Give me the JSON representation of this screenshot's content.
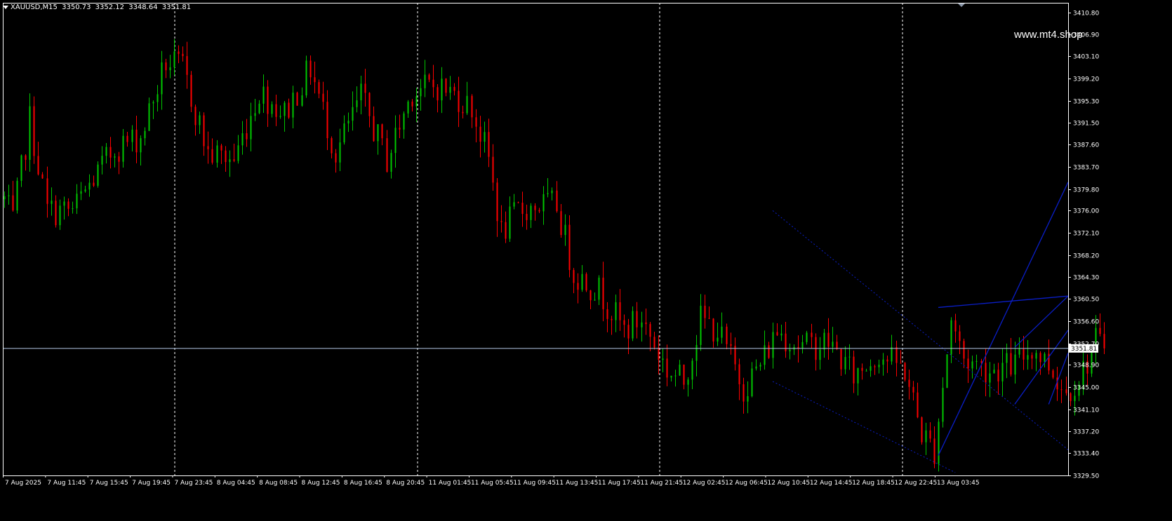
{
  "header": {
    "symbol": "XAUUSD,M15",
    "open": "3350.73",
    "high": "3352.12",
    "low": "3348.64",
    "close": "3351.81"
  },
  "watermark": "www.mt4.shop",
  "colors": {
    "background": "#000000",
    "bull": "#00c800",
    "bear": "#ff0000",
    "frame": "#ffffff",
    "separator": "#ffffff",
    "bid_line": "#b4c8e6",
    "trendline": "#0a1ec8"
  },
  "chart_data": {
    "type": "candlestick",
    "symbol": "XAUUSD",
    "timeframe": "M15",
    "y_range": [
      3329.5,
      3412.5
    ],
    "y_ticks": [
      "3410.80",
      "3406.90",
      "3403.10",
      "3399.20",
      "3395.30",
      "3391.50",
      "3387.60",
      "3383.70",
      "3379.80",
      "3376.00",
      "3372.10",
      "3368.20",
      "3364.30",
      "3360.50",
      "3356.60",
      "3352.70",
      "3348.90",
      "3345.00",
      "3341.10",
      "3337.20",
      "3333.40",
      "3329.50"
    ],
    "x_ticks": [
      "7 Aug 2025",
      "7 Aug 11:45",
      "7 Aug 15:45",
      "7 Aug 19:45",
      "7 Aug 23:45",
      "8 Aug 04:45",
      "8 Aug 08:45",
      "8 Aug 12:45",
      "8 Aug 16:45",
      "8 Aug 20:45",
      "11 Aug 01:45",
      "11 Aug 05:45",
      "11 Aug 09:45",
      "11 Aug 13:45",
      "11 Aug 17:45",
      "11 Aug 21:45",
      "12 Aug 02:45",
      "12 Aug 06:45",
      "12 Aug 10:45",
      "12 Aug 14:45",
      "12 Aug 18:45",
      "12 Aug 22:45",
      "13 Aug 03:45"
    ],
    "period_separators": [
      "8 Aug",
      "11 Aug",
      "12 Aug",
      "13 Aug"
    ],
    "current_price": "3351.81",
    "grid": false,
    "price_path": [
      {
        "t": 0,
        "p": 3378
      },
      {
        "t": 2,
        "p": 3374
      },
      {
        "t": 6,
        "p": 3392
      },
      {
        "t": 10,
        "p": 3376
      },
      {
        "t": 16,
        "p": 3376
      },
      {
        "t": 26,
        "p": 3387
      },
      {
        "t": 32,
        "p": 3389
      },
      {
        "t": 38,
        "p": 3402
      },
      {
        "t": 42,
        "p": 3401
      },
      {
        "t": 48,
        "p": 3386
      },
      {
        "t": 54,
        "p": 3385
      },
      {
        "t": 60,
        "p": 3397
      },
      {
        "t": 66,
        "p": 3393
      },
      {
        "t": 72,
        "p": 3401
      },
      {
        "t": 78,
        "p": 3386
      },
      {
        "t": 84,
        "p": 3396
      },
      {
        "t": 90,
        "p": 3385
      },
      {
        "t": 96,
        "p": 3397
      },
      {
        "t": 102,
        "p": 3398
      },
      {
        "t": 107,
        "p": 3396
      },
      {
        "t": 110,
        "p": 3394
      },
      {
        "t": 114,
        "p": 3385
      },
      {
        "t": 117,
        "p": 3372
      },
      {
        "t": 121,
        "p": 3376
      },
      {
        "t": 126,
        "p": 3377
      },
      {
        "t": 130,
        "p": 3377
      },
      {
        "t": 134,
        "p": 3365
      },
      {
        "t": 140,
        "p": 3362
      },
      {
        "t": 146,
        "p": 3355
      },
      {
        "t": 150,
        "p": 3357
      },
      {
        "t": 156,
        "p": 3348
      },
      {
        "t": 160,
        "p": 3346
      },
      {
        "t": 164,
        "p": 3357
      },
      {
        "t": 168,
        "p": 3355
      },
      {
        "t": 174,
        "p": 3345
      },
      {
        "t": 178,
        "p": 3349
      },
      {
        "t": 182,
        "p": 3355
      },
      {
        "t": 188,
        "p": 3352
      },
      {
        "t": 194,
        "p": 3353
      },
      {
        "t": 200,
        "p": 3347
      },
      {
        "t": 206,
        "p": 3351
      },
      {
        "t": 212,
        "p": 3348
      },
      {
        "t": 216,
        "p": 3337
      },
      {
        "t": 219,
        "p": 3334
      },
      {
        "t": 223,
        "p": 3357
      },
      {
        "t": 226,
        "p": 3350
      },
      {
        "t": 232,
        "p": 3348
      },
      {
        "t": 238,
        "p": 3349
      },
      {
        "t": 242,
        "p": 3352
      },
      {
        "t": 246,
        "p": 3349
      },
      {
        "t": 250,
        "p": 3344
      },
      {
        "t": 254,
        "p": 3348
      },
      {
        "t": 257,
        "p": 3353
      },
      {
        "t": 259,
        "p": 3351.81
      }
    ],
    "trendlines": [
      {
        "style": "dotted",
        "t1": 181,
        "p1": 3376,
        "t2": 290,
        "p2": 3334
      },
      {
        "style": "dotted",
        "t1": 181,
        "p1": 3346,
        "t2": 224,
        "p2": 3330
      },
      {
        "style": "solid",
        "t1": 220,
        "p1": 3333,
        "t2": 290,
        "p2": 3381
      },
      {
        "style": "solid",
        "t1": 220,
        "p1": 3359,
        "t2": 290,
        "p2": 3361
      },
      {
        "style": "solid",
        "t1": 238,
        "p1": 3342,
        "t2": 290,
        "p2": 3355
      },
      {
        "style": "solid",
        "t1": 238,
        "p1": 3352,
        "t2": 290,
        "p2": 3361
      },
      {
        "style": "solid",
        "t1": 246,
        "p1": 3342,
        "t2": 290,
        "p2": 3351
      }
    ]
  }
}
